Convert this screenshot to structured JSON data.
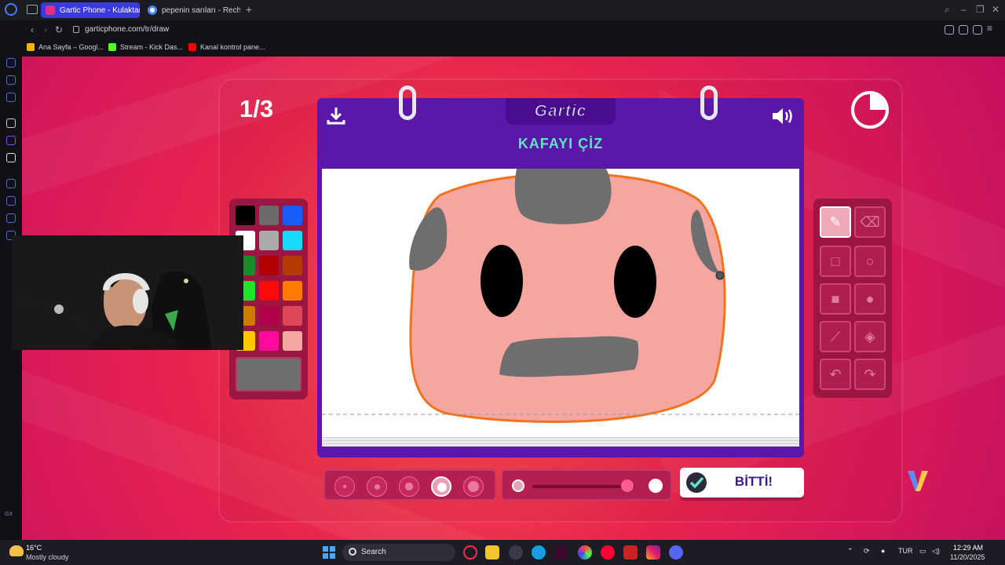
{
  "browser": {
    "tabs": [
      {
        "label": "Gartic Phone - Kulaktan K",
        "active": true
      },
      {
        "label": "pepenin sarıları - Recherc",
        "active": false
      }
    ],
    "url": "garticphone.com/tr/draw",
    "bookmarks": [
      {
        "label": "Ana Sayfa – Googl...",
        "color": "#f4b400"
      },
      {
        "label": "Stream - Kick Das...",
        "color": "#53fc18"
      },
      {
        "label": "Kanal kontrol pane...",
        "color": "#ff0000"
      }
    ],
    "sidebar_label": "GX"
  },
  "game": {
    "round": "1/3",
    "logo": "Gartic",
    "instruction": "KAFAYI ÇİZ",
    "done_label": "BİTTİ!",
    "timer_remaining_fraction": 0.75,
    "palette": {
      "colors": [
        "#000000",
        "#6b6b6b",
        "#1a5cff",
        "#ffffff",
        "#aaaaaa",
        "#1ad9ff",
        "#1a8a2a",
        "#b30000",
        "#b33a00",
        "#22e32a",
        "#ff0a0a",
        "#ff7a00",
        "#cc7a00",
        "#b3004a",
        "#e0485a",
        "#ffc800",
        "#ff0a9a",
        "#f7a6a6"
      ],
      "current_color": "#6f6f6f"
    },
    "tools": [
      {
        "name": "pencil",
        "selected": true
      },
      {
        "name": "eraser",
        "selected": false
      },
      {
        "name": "rectangle-outline",
        "selected": false
      },
      {
        "name": "ellipse-outline",
        "selected": false
      },
      {
        "name": "rectangle-filled",
        "selected": false
      },
      {
        "name": "ellipse-filled",
        "selected": false
      },
      {
        "name": "line",
        "selected": false
      },
      {
        "name": "fill-bucket",
        "selected": false
      },
      {
        "name": "undo",
        "selected": false
      },
      {
        "name": "redo",
        "selected": false
      }
    ],
    "brush_sizes": [
      {
        "size": 1,
        "selected": false
      },
      {
        "size": 2,
        "selected": false
      },
      {
        "size": 3,
        "selected": false
      },
      {
        "size": 4,
        "selected": true
      },
      {
        "size": 5,
        "selected": false
      }
    ],
    "opacity_value": 0.93,
    "accent_color": "#5b17a8",
    "instruction_color": "#5ee3c3"
  },
  "taskbar": {
    "weather_temp": "16°C",
    "weather_desc": "Mostly cloudy",
    "search_label": "Search",
    "language": "TUR",
    "time": "12:29 AM",
    "date": "11/20/2025"
  }
}
